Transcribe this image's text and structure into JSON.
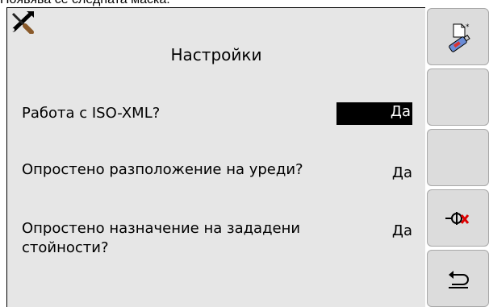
{
  "caption": "Появява се следната маска:",
  "screen": {
    "title": "Настройки",
    "rows": [
      {
        "label": "Работа с ISO-XML?",
        "value": "Да",
        "selected": true
      },
      {
        "label": "Опростено разположение на уреди?",
        "value": "Да",
        "selected": false
      },
      {
        "label": "Опростено назначение на зададени стойности?",
        "value": "Да",
        "selected": false
      }
    ]
  },
  "softkeys": [
    {
      "icon": "usb-stick-new-icon"
    },
    {
      "icon": ""
    },
    {
      "icon": ""
    },
    {
      "icon": "disconnect-icon"
    },
    {
      "icon": "back-arrow-icon"
    }
  ],
  "colors": {
    "panel_bg": "#e6e6e6",
    "softkey_bg": "#dcdcdc",
    "selection_bg": "#000000",
    "selection_fg": "#ffffff"
  }
}
